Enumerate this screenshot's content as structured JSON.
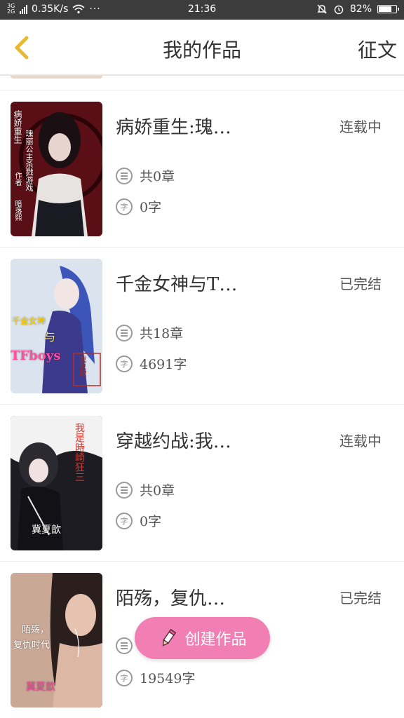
{
  "status_bar": {
    "network": "3G 2G",
    "speed": "0.35K/s",
    "more": "···",
    "time": "21:36",
    "battery": "82%",
    "battery_level": 0.82
  },
  "header": {
    "title": "我的作品",
    "action": "征文"
  },
  "works": [
    {
      "title": "病娇重生:瑰…",
      "status": "连载中",
      "chapters": "共0章",
      "words": "0字",
      "cover_lines": [
        "病娇重生",
        "瑰丽公主杀戮游戏",
        "作者",
        "暗落熙"
      ]
    },
    {
      "title": "千金女神与T…",
      "status": "已完结",
      "chapters": "共18章",
      "words": "4691字",
      "cover_lines": [
        "千金女神",
        "与",
        "TFboys",
        "冀夏歆"
      ]
    },
    {
      "title": "穿越约战:我…",
      "status": "连载中",
      "chapters": "共0章",
      "words": "0字",
      "cover_lines": [
        "我是時崎狂三",
        "冀夏歆"
      ]
    },
    {
      "title": "陌殇，复仇…",
      "status": "已完结",
      "chapters": "",
      "words": "19549字",
      "cover_lines": [
        "陌殇，",
        "复仇时代",
        "冀夏歆"
      ]
    }
  ],
  "word_icon_label": "字",
  "create_button": "创建作品",
  "colors": {
    "accent": "#f27fb3",
    "back_arrow": "#e8b830",
    "statusbar": "#3c3c3c"
  }
}
